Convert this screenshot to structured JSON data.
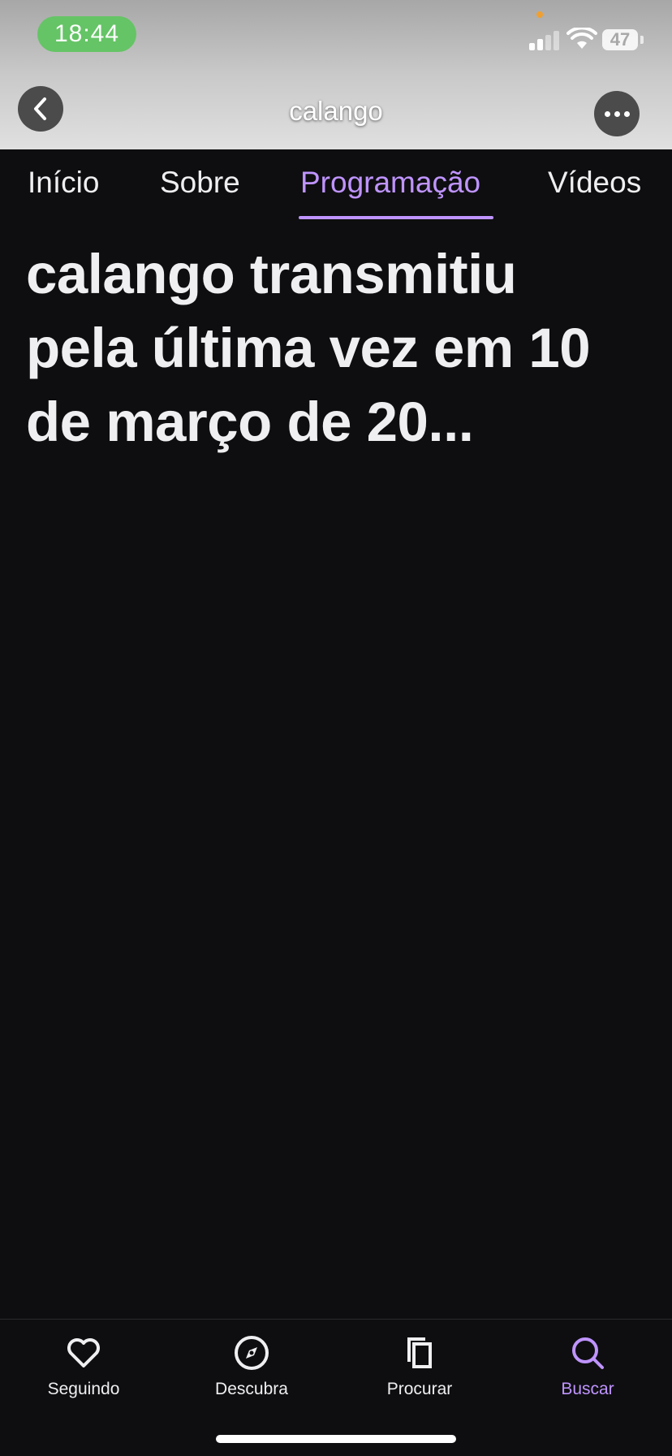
{
  "status_bar": {
    "time": "18:44",
    "battery": "47"
  },
  "nav": {
    "title": "calango",
    "back_icon": "chevron-left-icon",
    "more_icon": "ellipsis-icon"
  },
  "tabs": [
    {
      "label": "Início"
    },
    {
      "label": "Sobre"
    },
    {
      "label": "Programação",
      "active": true
    },
    {
      "label": "Vídeos"
    }
  ],
  "content": {
    "headline": "calango transmitiu pela última vez em 10 de março de 20..."
  },
  "bottom_nav": [
    {
      "label": "Seguindo",
      "icon": "heart-icon"
    },
    {
      "label": "Descubra",
      "icon": "compass-icon"
    },
    {
      "label": "Procurar",
      "icon": "copy-icon"
    },
    {
      "label": "Buscar",
      "icon": "search-icon",
      "active": true
    }
  ],
  "colors": {
    "accent": "#bf94ff",
    "background": "#0e0e10",
    "time_pill": "#65c466"
  }
}
